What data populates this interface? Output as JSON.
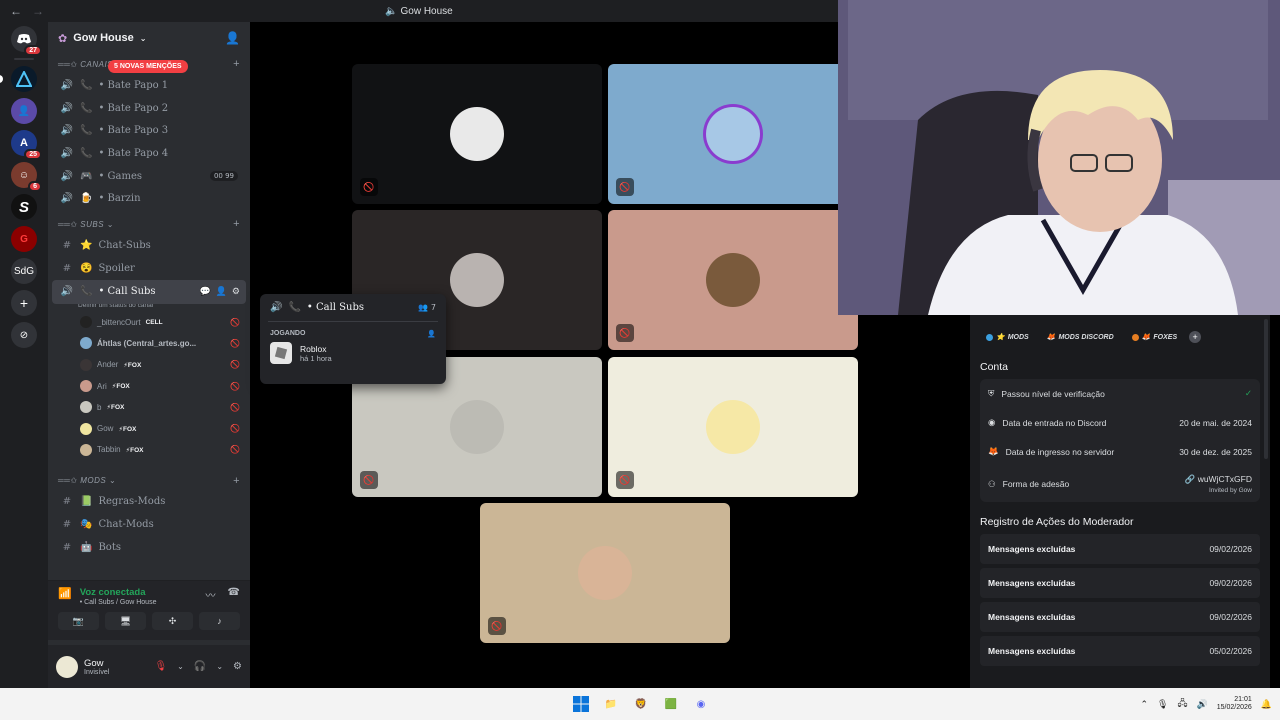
{
  "window": {
    "title": "Gow House",
    "back": "←",
    "forward": "→"
  },
  "rail": {
    "home_badge": "27",
    "badge_2": "25",
    "badge_3": "6",
    "sdg_label": "SdG"
  },
  "guild": {
    "name": "Gow House",
    "mentions_pill": "5 NOVAS MENÇÕES"
  },
  "categories": {
    "voz": "CANAIS DE VOZ",
    "subs": "SUBS",
    "mods": "MODS"
  },
  "voice_channels": [
    {
      "label": "• Bate Papo 1"
    },
    {
      "label": "• Bate Papo 2"
    },
    {
      "label": "• Bate Papo 3"
    },
    {
      "label": "• Bate Papo 4"
    },
    {
      "label": "• Games",
      "count": "00 99"
    },
    {
      "label": "• Barzin"
    }
  ],
  "subs_channels": [
    {
      "label": "Chat-Subs"
    },
    {
      "label": "Spoiler"
    }
  ],
  "active_channel": {
    "label": "• Call Subs",
    "sub": "Definir um status do canal"
  },
  "voice_users": [
    {
      "name": "_bittencOurt",
      "tag": "CELL"
    },
    {
      "name": "Áhtlas (Central_artes.go...",
      "tag": ""
    },
    {
      "name": "Ander",
      "tag": "⚡FOX"
    },
    {
      "name": "Ari",
      "tag": "⚡FOX"
    },
    {
      "name": "b",
      "tag": "⚡FOX"
    },
    {
      "name": "Gow",
      "tag": "⚡FOX"
    },
    {
      "name": "Tabbin",
      "tag": "⚡FOX"
    }
  ],
  "mods_channels": [
    {
      "label": "Regras-Mods"
    },
    {
      "label": "Chat-Mods"
    },
    {
      "label": "Bots"
    }
  ],
  "voice_panel": {
    "status": "Voz conectada",
    "location": "• Call Subs / Gow House"
  },
  "user_panel": {
    "name": "Gow",
    "status": "Invisível"
  },
  "popout": {
    "channel": "• Call Subs",
    "count": "7",
    "section": "JOGANDO",
    "game": "Roblox",
    "time": "há 1 hora"
  },
  "profile": {
    "roles": [
      {
        "label": "MODS",
        "color": "#3ba0e0"
      },
      {
        "label": "MODS DISCORD",
        "color": "#c27c4e"
      },
      {
        "label": "FOXES",
        "color": "#e67e22"
      }
    ],
    "account_title": "Conta",
    "account_rows": [
      {
        "label": "Passou nível de verificação",
        "value": ""
      },
      {
        "label": "Data de entrada no Discord",
        "value": "20 de mai. de 2024"
      },
      {
        "label": "Data de ingresso no servidor",
        "value": "30 de dez. de 2025"
      },
      {
        "label": "Forma de adesão",
        "value": "wuWjCTxGFD",
        "sub": "Invited by Gow"
      }
    ],
    "mod_log_title": "Registro de Ações do Moderador",
    "mod_log": [
      {
        "action": "Mensagens excluídas",
        "date": "09/02/2026"
      },
      {
        "action": "Mensagens excluídas",
        "date": "09/02/2026"
      },
      {
        "action": "Mensagens excluídas",
        "date": "09/02/2026"
      },
      {
        "action": "Mensagens excluídas",
        "date": "05/02/2026"
      }
    ]
  },
  "taskbar": {
    "time": "21:01",
    "date": "15/02/2026"
  },
  "tile_colors": [
    "#111214",
    "#7eaacd",
    "#2a2626",
    "#c99a8c",
    "#c9c8c0",
    "#efedde",
    "#cbb696"
  ],
  "colors": {
    "accent": "#5865f2",
    "online": "#23a55a",
    "danger": "#f23f43"
  }
}
